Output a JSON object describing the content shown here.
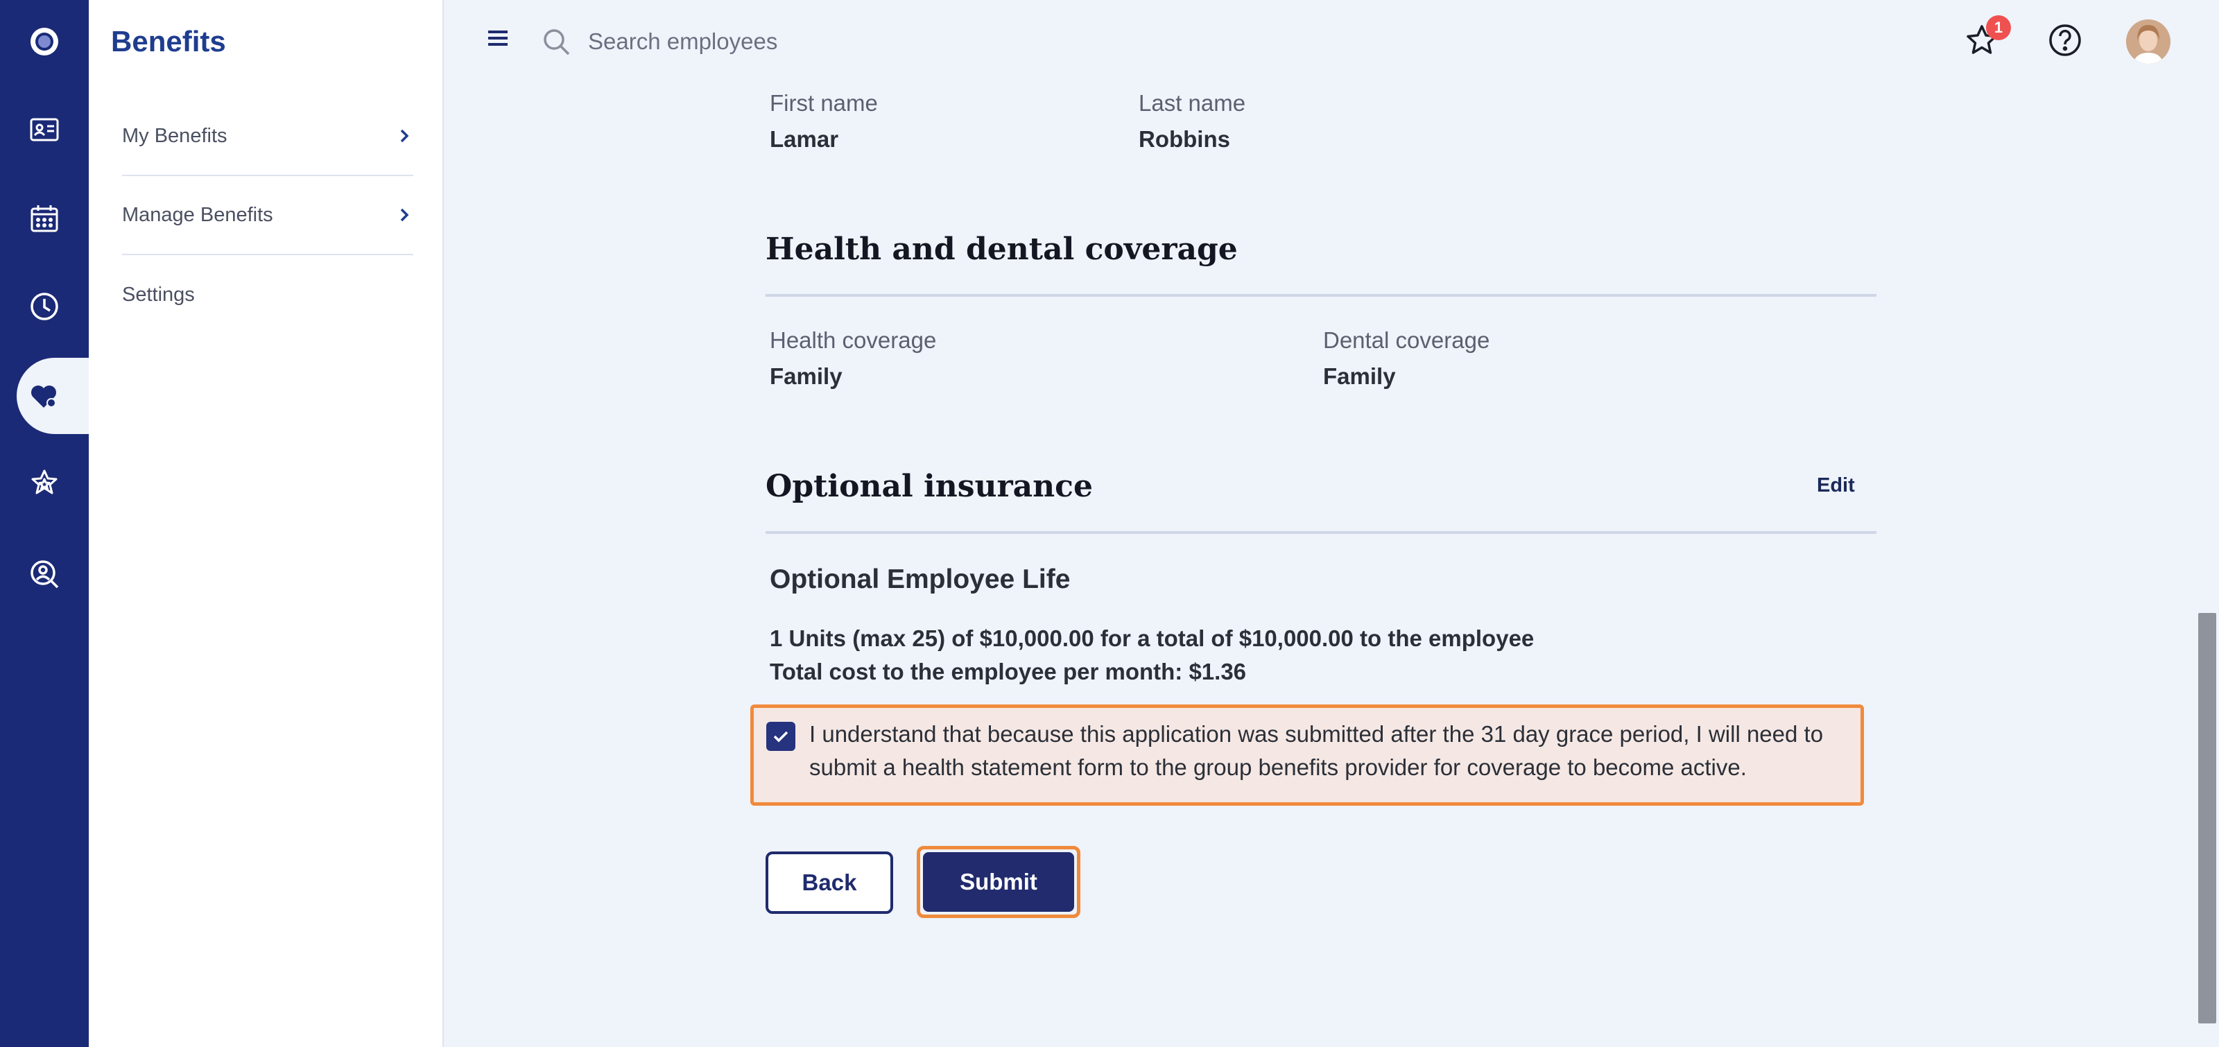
{
  "colors": {
    "rail_bg": "#1b2a76",
    "accent": "#212b6e",
    "highlight": "#f08a3c",
    "badge": "#ef5150"
  },
  "rail": {
    "items": [
      {
        "icon": "app-logo-icon"
      },
      {
        "icon": "id-card-icon"
      },
      {
        "icon": "calendar-icon"
      },
      {
        "icon": "clock-icon"
      },
      {
        "icon": "heart-benefits-icon",
        "active": true
      },
      {
        "icon": "star-badge-icon"
      },
      {
        "icon": "person-search-icon"
      }
    ]
  },
  "sidebar": {
    "title": "Benefits",
    "items": [
      {
        "label": "My Benefits",
        "has_chevron": true
      },
      {
        "label": "Manage Benefits",
        "has_chevron": true
      },
      {
        "label": "Settings",
        "has_chevron": false
      }
    ]
  },
  "topbar": {
    "search_placeholder": "Search employees",
    "notification_count": "1"
  },
  "employee": {
    "first_name_label": "First name",
    "first_name": "Lamar",
    "last_name_label": "Last name",
    "last_name": "Robbins"
  },
  "health": {
    "title": "Health and dental coverage",
    "health_label": "Health coverage",
    "health_value": "Family",
    "dental_label": "Dental coverage",
    "dental_value": "Family"
  },
  "optional": {
    "title": "Optional insurance",
    "edit_label": "Edit",
    "subtitle": "Optional Employee Life",
    "units_line": "1 Units (max 25) of $10,000.00 for a total of $10,000.00 to the employee",
    "cost_prefix": "Total cost to the employee per month: ",
    "cost_value": "$1.36",
    "acknowledgement": "I understand that because this application was submitted after the 31 day grace period, I will need to submit a health statement form to the group benefits provider for coverage to become active.",
    "acknowledged": true
  },
  "actions": {
    "back_label": "Back",
    "submit_label": "Submit"
  }
}
